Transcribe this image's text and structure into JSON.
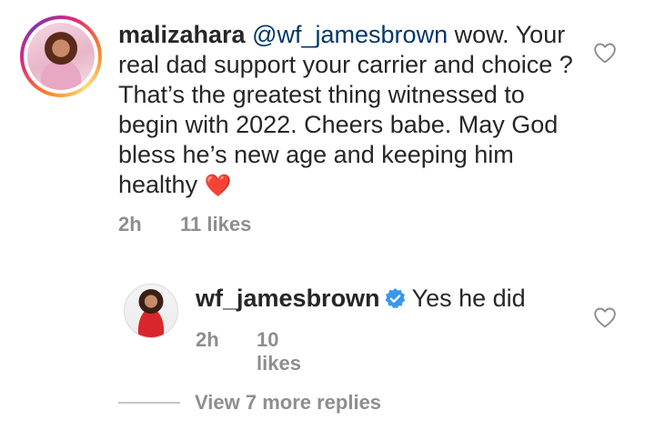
{
  "main_comment": {
    "username": "malizahara",
    "mention": "@wf_jamesbrown",
    "text": "wow. Your real dad support your carrier and choice ?  That’s the greatest thing witnessed to begin with 2022. Cheers babe. May God bless he’s new age and keeping him healthy",
    "emoji": "❤️",
    "time": "2h",
    "likes": "11 likes",
    "like_icon": "heart-outline-icon"
  },
  "reply": {
    "username": "wf_jamesbrown",
    "verified_icon": "verified-badge-icon",
    "text": "Yes he did",
    "time": "2h",
    "likes": "10 likes",
    "like_icon": "heart-outline-icon"
  },
  "view_replies": {
    "label": "View 7 more replies"
  },
  "colors": {
    "text": "#262626",
    "secondary": "#8e8e8e",
    "mention": "#00376b",
    "verified": "#3897f0"
  }
}
